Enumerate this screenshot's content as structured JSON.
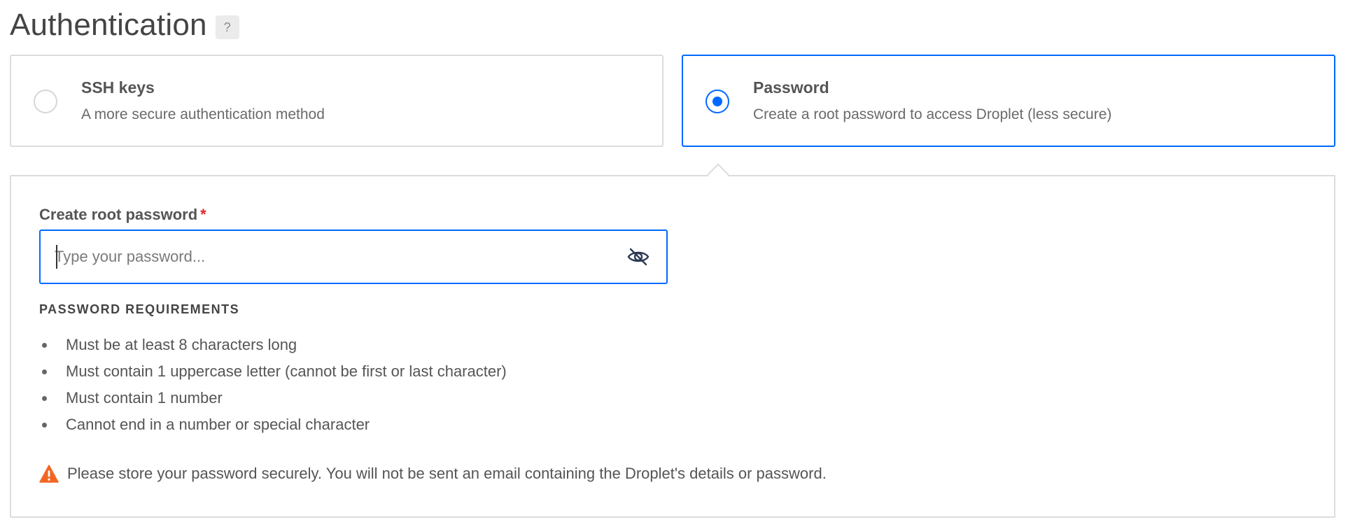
{
  "header": {
    "title": "Authentication",
    "help_label": "?"
  },
  "auth_options": {
    "ssh": {
      "title": "SSH keys",
      "description": "A more secure authentication method",
      "selected": false
    },
    "password": {
      "title": "Password",
      "description": "Create a root password to access Droplet (less secure)",
      "selected": true
    }
  },
  "password_panel": {
    "field_label": "Create root password",
    "required_marker": "*",
    "input_value": "",
    "input_placeholder": "Type your password...",
    "visibility_icon": "eye-slash-icon",
    "requirements_heading": "PASSWORD REQUIREMENTS",
    "requirements": [
      "Must be at least 8 characters long",
      "Must contain 1 uppercase letter (cannot be first or last character)",
      "Must contain 1 number",
      "Cannot end in a number or special character"
    ],
    "warning_icon": "warning-icon",
    "warning_text": "Please store your password securely. You will not be sent an email containing the Droplet's details or password."
  },
  "colors": {
    "accent": "#0069ff",
    "required": "#e0262b",
    "warning": "#f26622",
    "border": "#dcdcdc"
  }
}
